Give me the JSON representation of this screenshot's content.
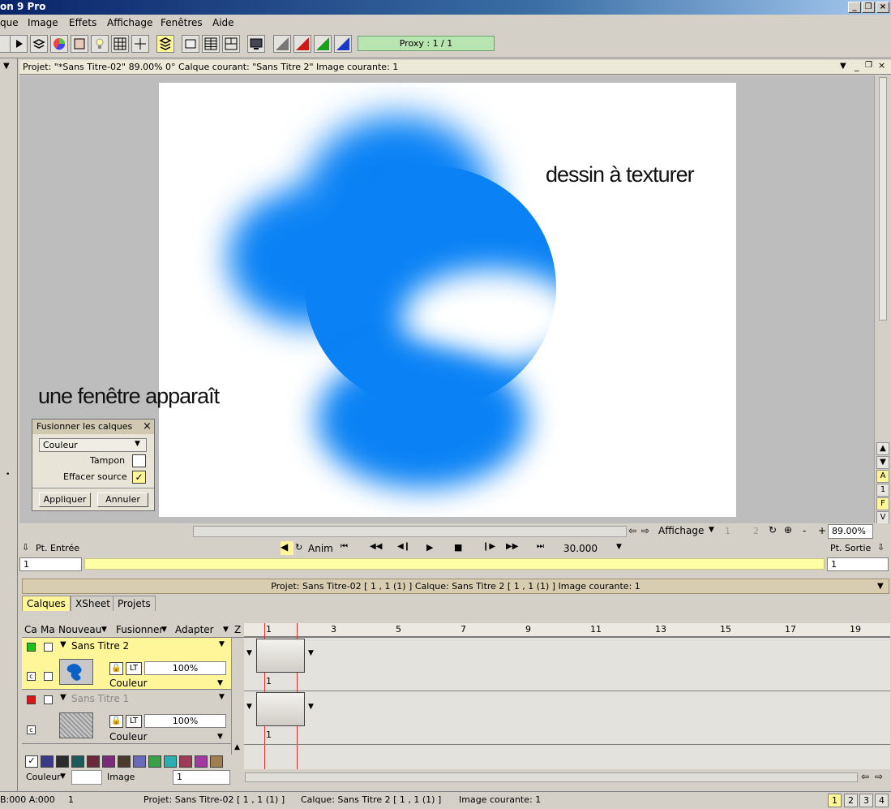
{
  "window": {
    "title": "on 9 Pro"
  },
  "menu": [
    "que",
    "Image",
    "Effets",
    "Affichage",
    "Fenêtres",
    "Aide"
  ],
  "toolbar": {
    "proxy": "Proxy : 1 / 1"
  },
  "view": {
    "header": "Projet:  \"*Sans Titre-02\"   89.00%   0°  Calque courant: \"Sans Titre 2\"  Image courante: 1"
  },
  "annotations": {
    "top": "dessin à texturer",
    "left": "une fenêtre apparaît"
  },
  "dialog": {
    "title": "Fusionner les calques",
    "mode": "Couleur",
    "tampon_label": "Tampon",
    "effacer_label": "Effacer source",
    "apply": "Appliquer",
    "cancel": "Annuler"
  },
  "viewbar": {
    "affichage": "Affichage",
    "zoom": "89.00%",
    "b1": "1",
    "b2": "2",
    "minus": "-",
    "plus": "+"
  },
  "playbar": {
    "pt_entree": "Pt. Entrée",
    "anim": "Anim",
    "fps": "30.000",
    "pt_sortie": "Pt. Sortie",
    "in_value": "1",
    "out_value": "1"
  },
  "scrollside": {
    "a": "A",
    "one": "1",
    "f": "F",
    "v": "V"
  },
  "info": {
    "line": "Projet: Sans Titre-02 [ 1 , 1  (1) ]        Calque: Sans Titre 2 [ 1 , 1  (1) ]        Image courante: 1"
  },
  "tabs": [
    "Calques",
    "XSheet",
    "Projets"
  ],
  "layer_header": {
    "ca": "Ca",
    "ma": "Ma",
    "nouveau": "Nouveau",
    "fusionner": "Fusionner",
    "adapter": "Adapter",
    "z": "Z"
  },
  "layers": [
    {
      "name": "Sans Titre 2",
      "lt": "LT",
      "opacity": "100%",
      "mode": "Couleur",
      "c": "c",
      "frame": "1"
    },
    {
      "name": "Sans Titre 1",
      "lt": "LT",
      "opacity": "100%",
      "mode": "Couleur",
      "c": "c",
      "frame": "1"
    }
  ],
  "ruler": [
    "1",
    "3",
    "5",
    "7",
    "9",
    "11",
    "13",
    "15",
    "17",
    "19"
  ],
  "swatches": [
    "#3a3a8a",
    "#2c2c2c",
    "#1f5a5a",
    "#6a2a3a",
    "#7a2a7a",
    "#4a3a2a",
    "#6a6ab8",
    "#3aa04a",
    "#2ab0b0",
    "#a03a5a",
    "#a03aa0",
    "#a08050"
  ],
  "bottom": {
    "couleur": "Couleur",
    "image": "Image",
    "image_value": "1"
  },
  "status": {
    "rgb": "B:000 A:000",
    "one": "1",
    "projet": "Projet: Sans Titre-02 [ 1 , 1  (1) ]",
    "calque": "Calque: Sans Titre 2 [ 1 , 1  (1) ]",
    "image": "Image courante: 1",
    "pages": [
      "1",
      "2",
      "3",
      "4"
    ]
  },
  "colors": {
    "blob": "#0a82f5",
    "highlight": "#fff599",
    "proxy": "#b9e6b0"
  }
}
